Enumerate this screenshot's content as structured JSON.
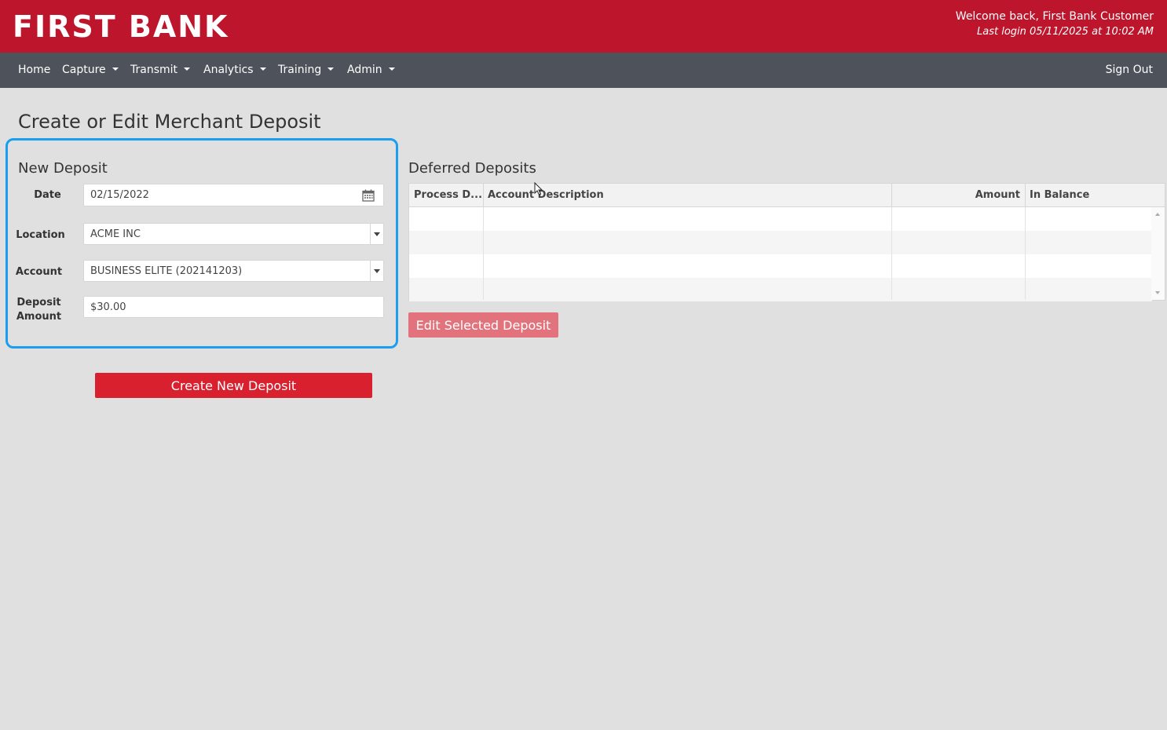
{
  "header": {
    "logo": "FIRST BANK",
    "welcome": "Welcome back, First Bank Customer",
    "last_login": "Last login 05/11/2025 at 10:02 AM"
  },
  "nav": {
    "items": [
      {
        "label": "Home",
        "dropdown": false
      },
      {
        "label": "Capture",
        "dropdown": true
      },
      {
        "label": "Transmit",
        "dropdown": true
      },
      {
        "label": "Analytics",
        "dropdown": true
      },
      {
        "label": "Training",
        "dropdown": true
      },
      {
        "label": "Admin",
        "dropdown": true
      }
    ],
    "sign_out": "Sign Out"
  },
  "page": {
    "title": "Create or Edit Merchant Deposit"
  },
  "new_deposit": {
    "title": "New Deposit",
    "date_label": "Date",
    "date_value": "02/15/2022",
    "location_label": "Location",
    "location_value": "ACME INC",
    "account_label": "Account",
    "account_value": "BUSINESS ELITE (202141203)",
    "amount_label_1": "Deposit",
    "amount_label_2": "Amount",
    "amount_value": "$30.00",
    "create_button": "Create New Deposit"
  },
  "deferred_deposits": {
    "title": "Deferred Deposits",
    "columns": [
      "Process D...",
      "Account Description",
      "Amount",
      "In Balance"
    ],
    "rows": [],
    "edit_button": "Edit Selected Deposit"
  },
  "colors": {
    "brand_red": "#bc152c",
    "nav_bg": "#4d525b",
    "button_red": "#d8202f",
    "button_disabled": "#e2737d",
    "highlight_blue": "#1a9ff0"
  }
}
